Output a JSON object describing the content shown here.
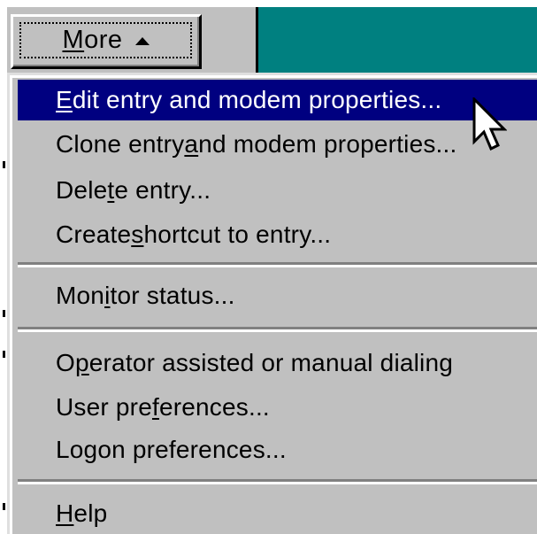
{
  "button": {
    "label": "More",
    "mnemonic_index": 0,
    "arrow_icon": "up-triangle-icon"
  },
  "menu": {
    "items": [
      {
        "label": "Edit entry and modem properties...",
        "mnemonic": "E",
        "selected": true
      },
      {
        "label": "Clone entry and modem properties...",
        "mnemonic": "a",
        "selected": false
      },
      {
        "label": "Delete entry...",
        "mnemonic": "t",
        "selected": false
      },
      {
        "label": "Create shortcut to entry...",
        "mnemonic": "s",
        "selected": false
      },
      {
        "label": "Monitor status...",
        "mnemonic": "i",
        "selected": false
      },
      {
        "label": "Operator assisted or manual dialing",
        "mnemonic": "p",
        "selected": false
      },
      {
        "label": "User preferences...",
        "mnemonic": "f",
        "selected": false
      },
      {
        "label": "Logon preferences...",
        "mnemonic": "",
        "selected": false
      },
      {
        "label": "Help",
        "mnemonic": "H",
        "selected": false
      }
    ]
  },
  "colors": {
    "highlight": "#000080",
    "face": "#c0c0c0",
    "desktop": "#008080"
  },
  "cursor_icon": "arrow-pointer-icon"
}
